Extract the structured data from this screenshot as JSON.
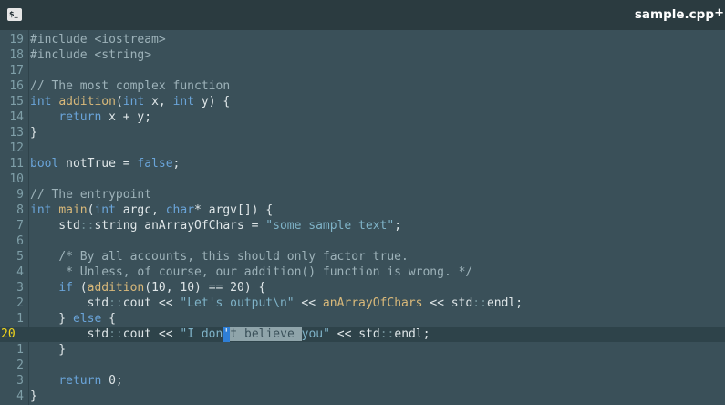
{
  "window": {
    "terminal_icon_label": "$_",
    "title": "sample.cpp",
    "modified_indicator": "+"
  },
  "colors": {
    "keyword": "#6aa4d9",
    "function": "#d9b97a",
    "string": "#7fb3c8",
    "comment": "#9db2b9",
    "current_line_number": "#f2d61b",
    "selection": "#8fa4aa",
    "cursor": "#2f7fd6"
  },
  "editor": {
    "lines": [
      {
        "num": "19",
        "tokens": [
          [
            "cm",
            "#include <iostream>"
          ]
        ]
      },
      {
        "num": "18",
        "tokens": [
          [
            "cm",
            "#include <string>"
          ]
        ]
      },
      {
        "num": "17",
        "tokens": []
      },
      {
        "num": "16",
        "tokens": [
          [
            "cm",
            "// The most complex function"
          ]
        ]
      },
      {
        "num": "15",
        "tokens": [
          [
            "kw",
            "int"
          ],
          [
            "pl",
            " "
          ],
          [
            "fn",
            "addition"
          ],
          [
            "pl",
            "("
          ],
          [
            "kw",
            "int"
          ],
          [
            "pl",
            " x, "
          ],
          [
            "kw",
            "int"
          ],
          [
            "pl",
            " y) {"
          ]
        ]
      },
      {
        "num": "14",
        "tokens": [
          [
            "pl",
            "    "
          ],
          [
            "kw",
            "return"
          ],
          [
            "pl",
            " x + y;"
          ]
        ]
      },
      {
        "num": "13",
        "tokens": [
          [
            "pl",
            "}"
          ]
        ]
      },
      {
        "num": "12",
        "tokens": []
      },
      {
        "num": "11",
        "tokens": [
          [
            "kw",
            "bool"
          ],
          [
            "pl",
            " notTrue = "
          ],
          [
            "kw",
            "false"
          ],
          [
            "pl",
            ";"
          ]
        ]
      },
      {
        "num": "10",
        "tokens": []
      },
      {
        "num": "9",
        "tokens": [
          [
            "cm",
            "// The entrypoint"
          ]
        ]
      },
      {
        "num": "8",
        "tokens": [
          [
            "kw",
            "int"
          ],
          [
            "pl",
            " "
          ],
          [
            "fn",
            "main"
          ],
          [
            "pl",
            "("
          ],
          [
            "kw",
            "int"
          ],
          [
            "pl",
            " argc, "
          ],
          [
            "kw",
            "char"
          ],
          [
            "pl",
            "* argv[]) {"
          ]
        ]
      },
      {
        "num": "7",
        "tokens": [
          [
            "pl",
            "    std"
          ],
          [
            "ns",
            "::"
          ],
          [
            "pl",
            "string anArrayOfChars = "
          ],
          [
            "str",
            "\"some sample text\""
          ],
          [
            "pl",
            ";"
          ]
        ]
      },
      {
        "num": "6",
        "tokens": []
      },
      {
        "num": "5",
        "tokens": [
          [
            "pl",
            "    "
          ],
          [
            "cm",
            "/* By all accounts, this should only factor true."
          ]
        ]
      },
      {
        "num": "4",
        "tokens": [
          [
            "cm",
            "     * Unless, of course, our addition() function is wrong. */"
          ]
        ]
      },
      {
        "num": "3",
        "tokens": [
          [
            "pl",
            "    "
          ],
          [
            "kw",
            "if"
          ],
          [
            "pl",
            " ("
          ],
          [
            "fn",
            "addition"
          ],
          [
            "pl",
            "(10, 10) == 20) {"
          ]
        ]
      },
      {
        "num": "2",
        "tokens": [
          [
            "pl",
            "        std"
          ],
          [
            "ns",
            "::"
          ],
          [
            "pl",
            "cout << "
          ],
          [
            "str",
            "\"Let's output\\n\""
          ],
          [
            "pl",
            " << "
          ],
          [
            "fn",
            "anArrayOfChars"
          ],
          [
            "pl",
            " << std"
          ],
          [
            "ns",
            "::"
          ],
          [
            "pl",
            "endl;"
          ]
        ]
      },
      {
        "num": "1",
        "tokens": [
          [
            "pl",
            "    } "
          ],
          [
            "kw",
            "else"
          ],
          [
            "pl",
            " {"
          ]
        ]
      },
      {
        "num": "20",
        "current": true,
        "tokens": [
          [
            "pl",
            "        std"
          ],
          [
            "ns",
            "::"
          ],
          [
            "pl",
            "cout << "
          ],
          [
            "str",
            "\"I don"
          ],
          [
            "cur",
            "'"
          ],
          [
            "sel",
            "t believe "
          ],
          [
            "str",
            "you\""
          ],
          [
            "pl",
            " << std"
          ],
          [
            "ns",
            "::"
          ],
          [
            "pl",
            "endl;"
          ]
        ]
      },
      {
        "num": "1",
        "tokens": [
          [
            "pl",
            "    }"
          ]
        ]
      },
      {
        "num": "2",
        "tokens": []
      },
      {
        "num": "3",
        "tokens": [
          [
            "pl",
            "    "
          ],
          [
            "kw",
            "return"
          ],
          [
            "pl",
            " 0;"
          ]
        ]
      },
      {
        "num": "4",
        "tokens": [
          [
            "pl",
            "}"
          ]
        ]
      }
    ]
  }
}
